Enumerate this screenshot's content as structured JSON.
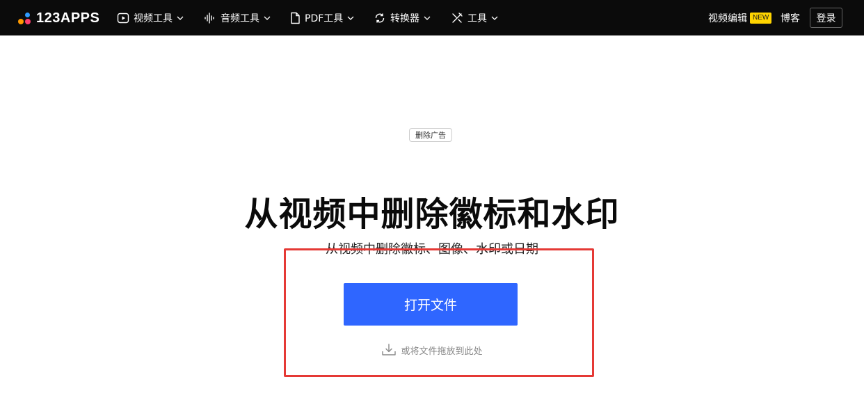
{
  "header": {
    "logo_text": "123APPS",
    "nav": [
      {
        "label": "视频工具",
        "icon": "play-circle-icon"
      },
      {
        "label": "音频工具",
        "icon": "audio-wave-icon"
      },
      {
        "label": "PDF工具",
        "icon": "document-icon"
      },
      {
        "label": "转换器",
        "icon": "convert-icon"
      },
      {
        "label": "工具",
        "icon": "tools-icon"
      }
    ],
    "video_editor_label": "视频编辑",
    "new_badge": "NEW",
    "blog_label": "博客",
    "login_label": "登录"
  },
  "main": {
    "remove_ads_label": "删除广告",
    "title": "从视频中删除徽标和水印",
    "subtitle": "从视频中删除徽标、图像、水印或日期",
    "open_file_label": "打开文件",
    "drop_hint": "或将文件拖放到此处"
  },
  "colors": {
    "header_bg": "#0b0b0b",
    "primary_button": "#2f66ff",
    "highlight_border": "#e53935",
    "new_badge": "#ffd400"
  }
}
